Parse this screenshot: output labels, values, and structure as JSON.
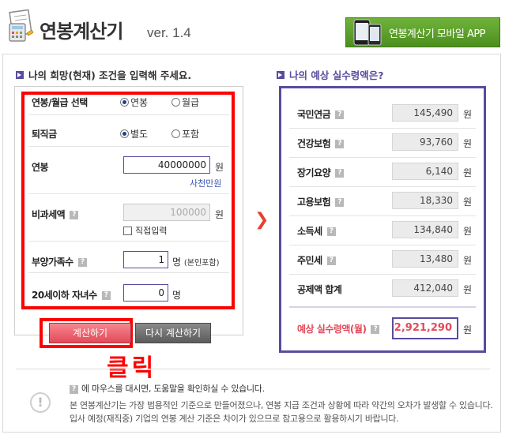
{
  "header": {
    "title": "연봉계산기",
    "version": "ver. 1.4",
    "mobile_app_label": "연봉계산기 모바일 APP",
    "logo_icon": "calculator-document-icon",
    "phone_icon": "smartphone-icon"
  },
  "input_section": {
    "title": "나의 희망(현재) 조건을 입력해 주세요.",
    "salary_type": {
      "label": "연봉/월급 선택",
      "options": [
        "연봉",
        "월급"
      ],
      "selected": "연봉"
    },
    "severance": {
      "label": "퇴직금",
      "options": [
        "별도",
        "포함"
      ],
      "selected": "별도"
    },
    "annual_salary": {
      "label": "연봉",
      "value": "40000000",
      "unit": "원",
      "korean_text": "사천만원"
    },
    "nontaxable": {
      "label": "비과세액",
      "value": "100000",
      "unit": "원",
      "checkbox_label": "직접입력",
      "checked": false
    },
    "dependents": {
      "label": "부양가족수",
      "value": "1",
      "unit": "명",
      "note": "(본인포함)"
    },
    "children": {
      "label": "20세이하 자녀수",
      "value": "0",
      "unit": "명"
    },
    "calc_button": "계산하기",
    "recalc_button": "다시 계산하기",
    "click_note": "클릭"
  },
  "result_section": {
    "title": "나의 예상 실수령액은?",
    "unit": "원",
    "rows": [
      {
        "label": "국민연금",
        "value": "145,490"
      },
      {
        "label": "건강보험",
        "value": "93,760"
      },
      {
        "label": "장기요양",
        "value": "6,140"
      },
      {
        "label": "고용보험",
        "value": "18,330"
      },
      {
        "label": "소득세",
        "value": "134,840"
      },
      {
        "label": "주민세",
        "value": "13,480"
      },
      {
        "label": "공제액 합계",
        "value": "412,040"
      }
    ],
    "net": {
      "label": "예상 실수령액(월)",
      "value": "2,921,290"
    }
  },
  "info": {
    "line1": "에 마우스를 대시면, 도움말을 확인하실 수 있습니다.",
    "line2": "본 연봉계산기는 가장 범용적인 기준으로 만들어졌으나, 연봉 지급 조건과 상황에 따라 약간의 오차가 발생할 수 있습니다.",
    "line3": "입사 예정(재직중) 기업의 연봉 계산 기준은 차이가 있으므로 참고용으로 활용하시기 바랍니다."
  },
  "colors": {
    "accent": "#5a4b9e",
    "highlight": "#ff0000",
    "calc_button": "#e24a58",
    "arrow": "#e8402f"
  }
}
